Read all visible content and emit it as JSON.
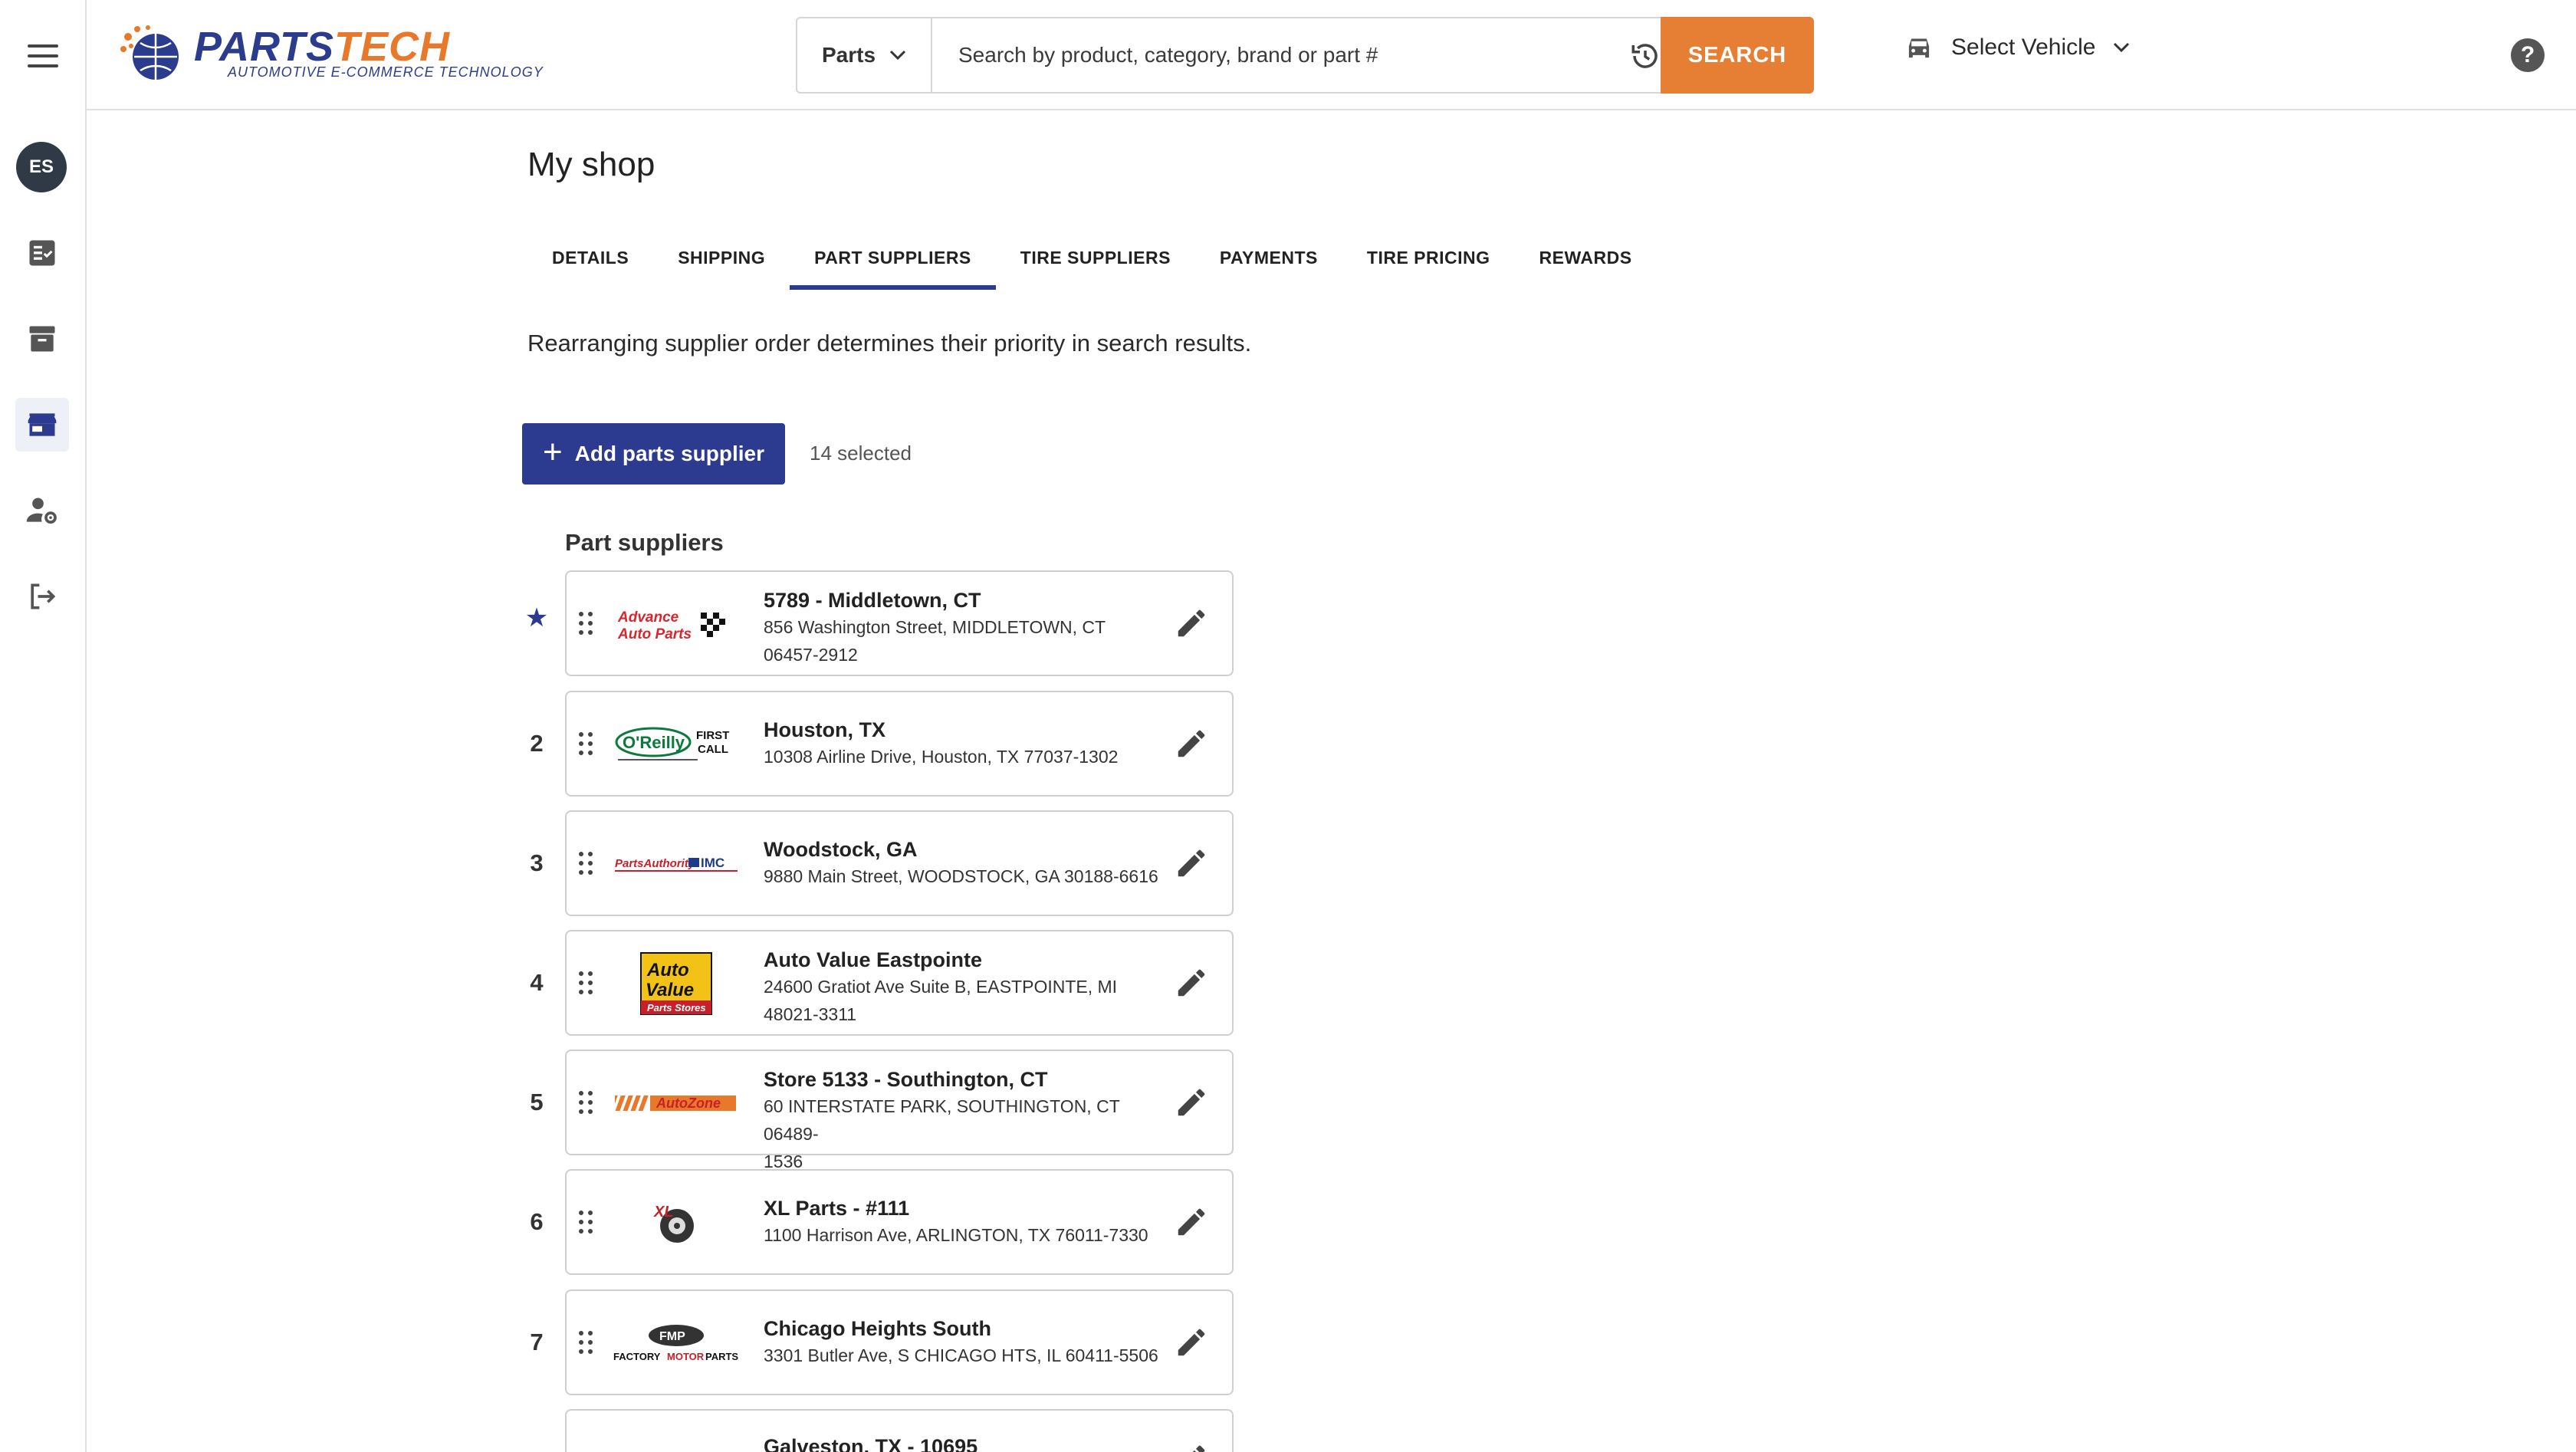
{
  "brand": {
    "wordmark_a": "PARTS",
    "wordmark_b": "TECH",
    "tagline": "AUTOMOTIVE E-COMMERCE TECHNOLOGY"
  },
  "search": {
    "category": "Parts",
    "placeholder": "Search by product, category, brand or part #",
    "button": "SEARCH"
  },
  "vehicle": {
    "label": "Select Vehicle"
  },
  "help": {
    "label": "?"
  },
  "user": {
    "initials": "ES"
  },
  "page": {
    "title": "My shop",
    "tabs": [
      {
        "label": "DETAILS"
      },
      {
        "label": "SHIPPING"
      },
      {
        "label": "PART SUPPLIERS"
      },
      {
        "label": "TIRE SUPPLIERS"
      },
      {
        "label": "PAYMENTS"
      },
      {
        "label": "TIRE PRICING"
      },
      {
        "label": "REWARDS"
      }
    ],
    "active_tab": "PART SUPPLIERS",
    "hint": "Rearranging supplier order determines their priority in search results.",
    "add_button": "Add parts supplier",
    "selected_count": "14 selected",
    "section_title": "Part suppliers"
  },
  "suppliers": [
    {
      "rank": "★",
      "logo": "Advance Auto Parts",
      "name": "5789 - Middletown, CT",
      "addr1": "856 Washington Street, MIDDLETOWN, CT",
      "addr2": "06457-2912"
    },
    {
      "rank": "2",
      "logo": "O'Reilly First Call",
      "name": "Houston, TX",
      "addr1": "10308 Airline Drive, Houston, TX 77037-1302",
      "addr2": ""
    },
    {
      "rank": "3",
      "logo": "Parts Authority / IMC",
      "name": "Woodstock, GA",
      "addr1": "9880 Main Street, WOODSTOCK, GA 30188-6616",
      "addr2": ""
    },
    {
      "rank": "4",
      "logo": "Auto Value Parts Stores",
      "name": "Auto Value Eastpointe",
      "addr1": "24600 Gratiot Ave Suite B, EASTPOINTE, MI",
      "addr2": "48021-3311"
    },
    {
      "rank": "5",
      "logo": "AutoZone",
      "name": "Store 5133 - Southington, CT",
      "addr1": "60 INTERSTATE PARK, SOUTHINGTON, CT 06489-",
      "addr2": "1536"
    },
    {
      "rank": "6",
      "logo": "XL Parts",
      "name": "XL Parts - #111",
      "addr1": "1100 Harrison Ave, ARLINGTON, TX 76011-7330",
      "addr2": ""
    },
    {
      "rank": "7",
      "logo": "Factory Motor Parts",
      "name": "Chicago Heights South",
      "addr1": "3301 Butler Ave, S CHICAGO HTS, IL 60411-5506",
      "addr2": ""
    },
    {
      "rank": "",
      "logo": "",
      "name": "Galveston, TX - 10695",
      "addr1": "",
      "addr2": ""
    }
  ],
  "colors": {
    "primary": "#2c3a8f",
    "accent": "#e67e33"
  }
}
